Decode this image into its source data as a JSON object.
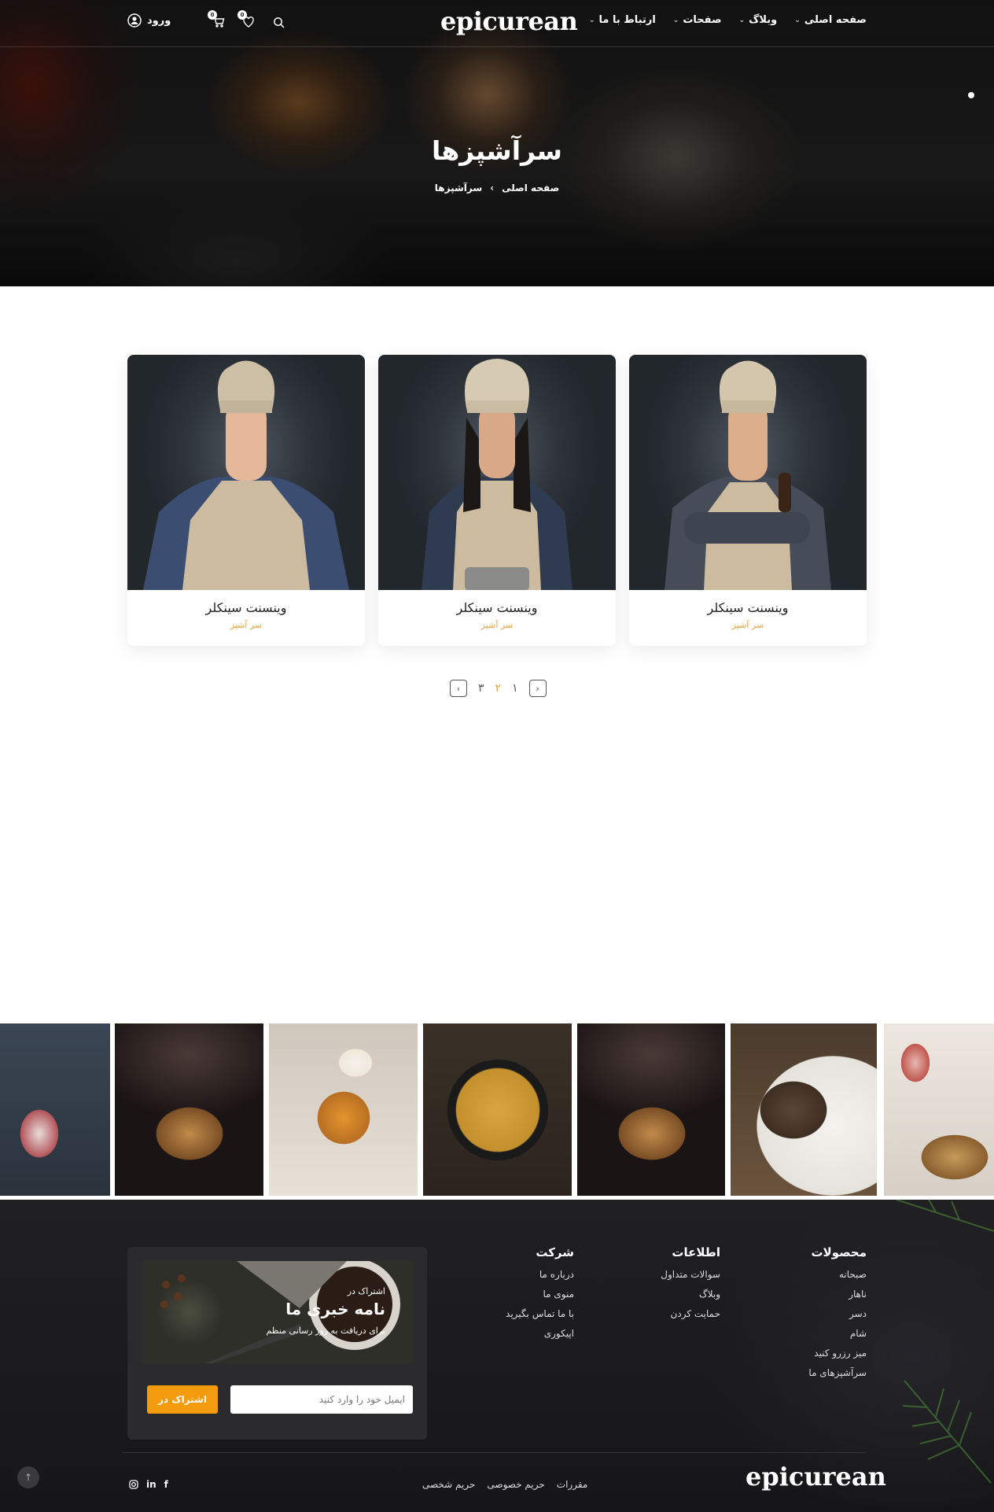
{
  "header": {
    "logo": "epicurean",
    "nav": [
      {
        "label": "صفحه اصلی",
        "has_dropdown": true
      },
      {
        "label": "وبلاگ",
        "has_dropdown": true
      },
      {
        "label": "صفحات",
        "has_dropdown": true
      },
      {
        "label": "ارتباط با ما",
        "has_dropdown": true
      }
    ],
    "cart_count": "0",
    "wishlist_count": "0",
    "login_label": "ورود"
  },
  "hero": {
    "title": "سرآشپزها",
    "breadcrumb": [
      "صفحه اصلی",
      "سرآشپزها"
    ]
  },
  "chefs": [
    {
      "name": "وینسنت سینکلر",
      "role": "سر آشپز"
    },
    {
      "name": "وینسنت سینکلر",
      "role": "سر آشپز"
    },
    {
      "name": "وینسنت سینکلر",
      "role": "سر آشپز"
    }
  ],
  "pagination": {
    "pages": [
      "۱",
      "۲",
      "۳"
    ],
    "active": "۲"
  },
  "footer": {
    "columns": [
      {
        "title": "محصولات",
        "items": [
          "صبحانه",
          "ناهار",
          "دسر",
          "شام",
          "میز رزرو کنید",
          "سرآشپزهای ما"
        ]
      },
      {
        "title": "اطلاعات",
        "items": [
          "سوالات متداول",
          "وبلاگ",
          "حمایت کردن"
        ]
      },
      {
        "title": "شرکت",
        "items": [
          "درباره ما",
          "منوی ما",
          "با ما تماس بگیرید",
          "اپیکوری"
        ]
      }
    ],
    "newsletter": {
      "subtitle": "اشتراک در",
      "title": "نامه خبری ما",
      "description": "برای دریافت به روز رسانی منظم",
      "email_placeholder": "ایمیل خود را وارد کنید",
      "button": "اشتراک در"
    },
    "logo": "epicurean",
    "links": [
      "مقررات",
      "حریم خصوصی",
      "حریم شخصی"
    ],
    "social": [
      "instagram-icon",
      "linkedin-icon",
      "facebook-icon"
    ]
  }
}
